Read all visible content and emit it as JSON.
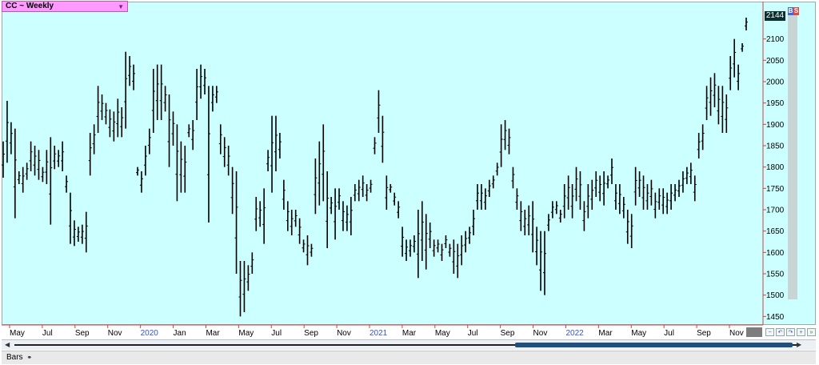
{
  "window": {
    "title": "CC ~ Weekly",
    "dropdown_icon": "triangle-down-icon"
  },
  "price_panel": {
    "last_price": "2144",
    "buy_label": "B",
    "sell_label": "S"
  },
  "bottom_bar": {
    "tab_label": "Bars",
    "tab_icon": "link-icon"
  },
  "scrollbar": {
    "left_icon": "left-arrow-icon",
    "right_icon": "right-arrow-icon",
    "thumb_start": 0.64,
    "thumb_end": 0.995
  },
  "toolbar_icons": [
    "zoom-out-icon",
    "undo-icon",
    "redo-icon",
    "zoom-in-icon",
    "forward-icon",
    "close-icon"
  ],
  "colors": {
    "plot_background": "#ccffff",
    "bar_color": "#000000",
    "title_background": "#ff99ff",
    "year_label": "#3355cc",
    "last_price_background": "#0b2f2f"
  },
  "chart_data": {
    "type": "ohlc",
    "title": "CC ~ Weekly",
    "y_axis": {
      "ticks": [
        1450,
        1500,
        1550,
        1600,
        1650,
        1700,
        1750,
        1800,
        1850,
        1900,
        1950,
        2000,
        2050,
        2100
      ],
      "range": [
        1430,
        2165
      ],
      "position": "right"
    },
    "x_axis": {
      "labels": [
        "May",
        "Jul",
        "Sep",
        "Nov",
        "2020",
        "Jan",
        "Mar",
        "May",
        "Jul",
        "Sep",
        "Nov",
        "2021",
        "Mar",
        "May",
        "Jul",
        "Sep",
        "Nov",
        "2022",
        "Mar",
        "May",
        "Jul",
        "Sep",
        "Nov"
      ],
      "year_labels": [
        "2020",
        "2021",
        "2022"
      ]
    },
    "grid": false,
    "series": [
      {
        "values": [
          [
            1775,
            1860
          ],
          [
            1810,
            1955
          ],
          [
            1830,
            1905
          ],
          [
            1680,
            1890
          ],
          [
            1760,
            1790
          ],
          [
            1740,
            1800
          ],
          [
            1770,
            1810
          ],
          [
            1790,
            1860
          ],
          [
            1780,
            1850
          ],
          [
            1770,
            1840
          ],
          [
            1765,
            1800
          ],
          [
            1760,
            1840
          ],
          [
            1665,
            1870
          ],
          [
            1795,
            1850
          ],
          [
            1800,
            1840
          ],
          [
            1790,
            1860
          ],
          [
            1740,
            1780
          ],
          [
            1620,
            1740
          ],
          [
            1615,
            1675
          ],
          [
            1625,
            1660
          ],
          [
            1620,
            1665
          ],
          [
            1600,
            1695
          ],
          [
            1780,
            1880
          ],
          [
            1830,
            1900
          ],
          [
            1880,
            1990
          ],
          [
            1910,
            1970
          ],
          [
            1900,
            1950
          ],
          [
            1870,
            1935
          ],
          [
            1860,
            1930
          ],
          [
            1870,
            1960
          ],
          [
            1870,
            1940
          ],
          [
            1890,
            2070
          ],
          [
            1990,
            2060
          ],
          [
            1980,
            2040
          ],
          [
            1780,
            1800
          ],
          [
            1740,
            1790
          ],
          [
            1780,
            1850
          ],
          [
            1830,
            1890
          ],
          [
            1880,
            2030
          ],
          [
            1910,
            2040
          ],
          [
            1910,
            2040
          ],
          [
            1930,
            1990
          ],
          [
            1800,
            1970
          ],
          [
            1850,
            1930
          ],
          [
            1720,
            1900
          ],
          [
            1740,
            1860
          ],
          [
            1740,
            1850
          ],
          [
            1870,
            1900
          ],
          [
            1840,
            1910
          ],
          [
            1910,
            2030
          ],
          [
            1960,
            2040
          ],
          [
            1970,
            2030
          ],
          [
            1670,
            1990
          ],
          [
            1930,
            1990
          ],
          [
            1950,
            1990
          ],
          [
            1830,
            1900
          ],
          [
            1800,
            1870
          ],
          [
            1780,
            1850
          ],
          [
            1690,
            1800
          ],
          [
            1550,
            1790
          ],
          [
            1450,
            1580
          ],
          [
            1460,
            1580
          ],
          [
            1510,
            1570
          ],
          [
            1550,
            1600
          ],
          [
            1650,
            1730
          ],
          [
            1660,
            1720
          ],
          [
            1620,
            1750
          ],
          [
            1790,
            1840
          ],
          [
            1740,
            1920
          ],
          [
            1790,
            1920
          ],
          [
            1820,
            1880
          ],
          [
            1700,
            1770
          ],
          [
            1650,
            1720
          ],
          [
            1640,
            1700
          ],
          [
            1660,
            1700
          ],
          [
            1620,
            1680
          ],
          [
            1600,
            1630
          ],
          [
            1570,
            1640
          ],
          [
            1590,
            1620
          ],
          [
            1690,
            1820
          ],
          [
            1710,
            1860
          ],
          [
            1720,
            1900
          ],
          [
            1610,
            1790
          ],
          [
            1690,
            1730
          ],
          [
            1630,
            1750
          ],
          [
            1700,
            1750
          ],
          [
            1650,
            1720
          ],
          [
            1650,
            1710
          ],
          [
            1640,
            1730
          ],
          [
            1720,
            1760
          ],
          [
            1720,
            1770
          ],
          [
            1730,
            1780
          ],
          [
            1720,
            1760
          ],
          [
            1740,
            1770
          ],
          [
            1830,
            1870
          ],
          [
            1880,
            1980
          ],
          [
            1810,
            1920
          ],
          [
            1700,
            1780
          ],
          [
            1740,
            1760
          ],
          [
            1710,
            1740
          ],
          [
            1680,
            1720
          ],
          [
            1590,
            1660
          ],
          [
            1580,
            1630
          ],
          [
            1590,
            1630
          ],
          [
            1600,
            1640
          ],
          [
            1540,
            1700
          ],
          [
            1580,
            1720
          ],
          [
            1560,
            1690
          ],
          [
            1610,
            1670
          ],
          [
            1590,
            1630
          ],
          [
            1600,
            1630
          ],
          [
            1580,
            1620
          ],
          [
            1610,
            1640
          ],
          [
            1590,
            1620
          ],
          [
            1550,
            1630
          ],
          [
            1540,
            1620
          ],
          [
            1570,
            1640
          ],
          [
            1600,
            1650
          ],
          [
            1620,
            1660
          ],
          [
            1640,
            1700
          ],
          [
            1700,
            1760
          ],
          [
            1700,
            1760
          ],
          [
            1700,
            1750
          ],
          [
            1730,
            1770
          ],
          [
            1750,
            1780
          ],
          [
            1780,
            1810
          ],
          [
            1800,
            1900
          ],
          [
            1840,
            1910
          ],
          [
            1830,
            1890
          ],
          [
            1750,
            1800
          ],
          [
            1700,
            1750
          ],
          [
            1650,
            1720
          ],
          [
            1640,
            1700
          ],
          [
            1640,
            1710
          ],
          [
            1600,
            1720
          ],
          [
            1570,
            1660
          ],
          [
            1510,
            1650
          ],
          [
            1500,
            1650
          ],
          [
            1650,
            1690
          ],
          [
            1680,
            1720
          ],
          [
            1690,
            1720
          ],
          [
            1670,
            1700
          ],
          [
            1680,
            1760
          ],
          [
            1700,
            1780
          ],
          [
            1680,
            1760
          ],
          [
            1720,
            1800
          ],
          [
            1700,
            1790
          ],
          [
            1650,
            1720
          ],
          [
            1680,
            1760
          ],
          [
            1700,
            1770
          ],
          [
            1730,
            1790
          ],
          [
            1720,
            1780
          ],
          [
            1710,
            1790
          ],
          [
            1750,
            1780
          ],
          [
            1760,
            1820
          ],
          [
            1700,
            1760
          ],
          [
            1690,
            1760
          ],
          [
            1680,
            1730
          ],
          [
            1620,
            1700
          ],
          [
            1610,
            1690
          ],
          [
            1710,
            1800
          ],
          [
            1730,
            1790
          ],
          [
            1700,
            1780
          ],
          [
            1700,
            1760
          ],
          [
            1710,
            1770
          ],
          [
            1680,
            1740
          ],
          [
            1700,
            1750
          ],
          [
            1690,
            1750
          ],
          [
            1690,
            1740
          ],
          [
            1700,
            1760
          ],
          [
            1720,
            1760
          ],
          [
            1730,
            1770
          ],
          [
            1740,
            1790
          ],
          [
            1760,
            1800
          ],
          [
            1760,
            1810
          ],
          [
            1720,
            1780
          ],
          [
            1820,
            1880
          ],
          [
            1840,
            1900
          ],
          [
            1910,
            1990
          ],
          [
            1920,
            2010
          ],
          [
            1940,
            2020
          ],
          [
            1900,
            1990
          ],
          [
            1880,
            1990
          ],
          [
            1880,
            1970
          ],
          [
            1980,
            2060
          ],
          [
            2010,
            2100
          ],
          [
            1980,
            2040
          ],
          [
            2070,
            2090
          ],
          [
            2120,
            2150
          ]
        ]
      }
    ]
  }
}
